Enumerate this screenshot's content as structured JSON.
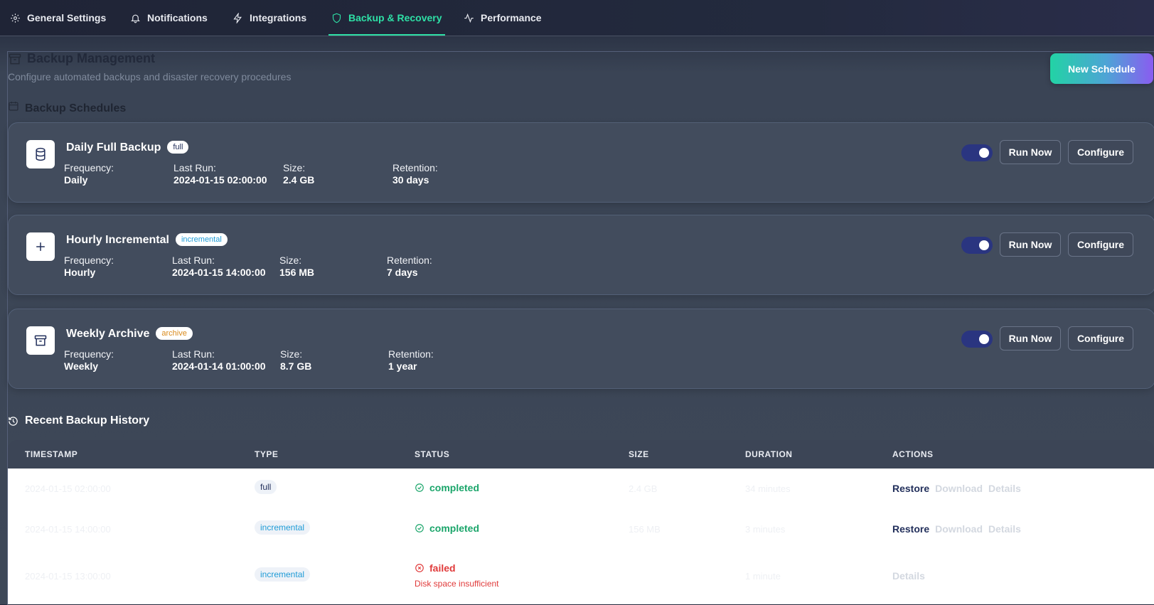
{
  "tabs": [
    {
      "label": "General Settings",
      "icon": "gear-icon"
    },
    {
      "label": "Notifications",
      "icon": "bell-icon"
    },
    {
      "label": "Integrations",
      "icon": "bolt-icon"
    },
    {
      "label": "Backup & Recovery",
      "icon": "shield-icon",
      "active": true
    },
    {
      "label": "Performance",
      "icon": "activity-icon"
    }
  ],
  "header": {
    "title": "Backup Management",
    "subtitle": "Configure automated backups and disaster recovery procedures",
    "new_button": "New Schedule"
  },
  "schedules_title": "Backup Schedules",
  "schedules": [
    {
      "name": "Daily Full Backup",
      "type": "full",
      "icon": "database-icon",
      "frequency_label": "Frequency:",
      "frequency": "Daily",
      "last_run_label": "Last Run:",
      "last_run": "2024-01-15 02:00:00",
      "size_label": "Size:",
      "size": "2.4 GB",
      "retention_label": "Retention:",
      "retention": "30 days",
      "enabled": true,
      "run_label": "Run Now",
      "configure_label": "Configure"
    },
    {
      "name": "Hourly Incremental",
      "type": "incremental",
      "icon": "plus-icon",
      "frequency_label": "Frequency:",
      "frequency": "Hourly",
      "last_run_label": "Last Run:",
      "last_run": "2024-01-15 14:00:00",
      "size_label": "Size:",
      "size": "156 MB",
      "retention_label": "Retention:",
      "retention": "7 days",
      "enabled": true,
      "run_label": "Run Now",
      "configure_label": "Configure"
    },
    {
      "name": "Weekly Archive",
      "type": "archive",
      "icon": "archive-icon",
      "frequency_label": "Frequency:",
      "frequency": "Weekly",
      "last_run_label": "Last Run:",
      "last_run": "2024-01-14 01:00:00",
      "size_label": "Size:",
      "size": "8.7 GB",
      "retention_label": "Retention:",
      "retention": "1 year",
      "enabled": true,
      "run_label": "Run Now",
      "configure_label": "Configure"
    }
  ],
  "history": {
    "title": "Recent Backup History",
    "columns": [
      "TIMESTAMP",
      "TYPE",
      "STATUS",
      "SIZE",
      "DURATION",
      "ACTIONS"
    ],
    "rows": [
      {
        "timestamp": "2024-01-15 02:00:00",
        "type": "full",
        "status": "completed",
        "size": "2.4 GB",
        "duration": "34 minutes",
        "actions": [
          "Restore",
          "Download",
          "Details"
        ]
      },
      {
        "timestamp": "2024-01-15 14:00:00",
        "type": "incremental",
        "status": "completed",
        "size": "156 MB",
        "duration": "3 minutes",
        "actions": [
          "Restore",
          "Download",
          "Details"
        ]
      },
      {
        "timestamp": "2024-01-15 13:00:00",
        "type": "incremental",
        "status": "failed",
        "error": "Disk space insufficient",
        "size": "",
        "duration": "1 minute",
        "actions": [
          "Details"
        ]
      }
    ]
  },
  "colors": {
    "accent": "#2ee0a6",
    "toggle": "#2a3580",
    "success": "#1aa56a",
    "error": "#e03a3a"
  }
}
